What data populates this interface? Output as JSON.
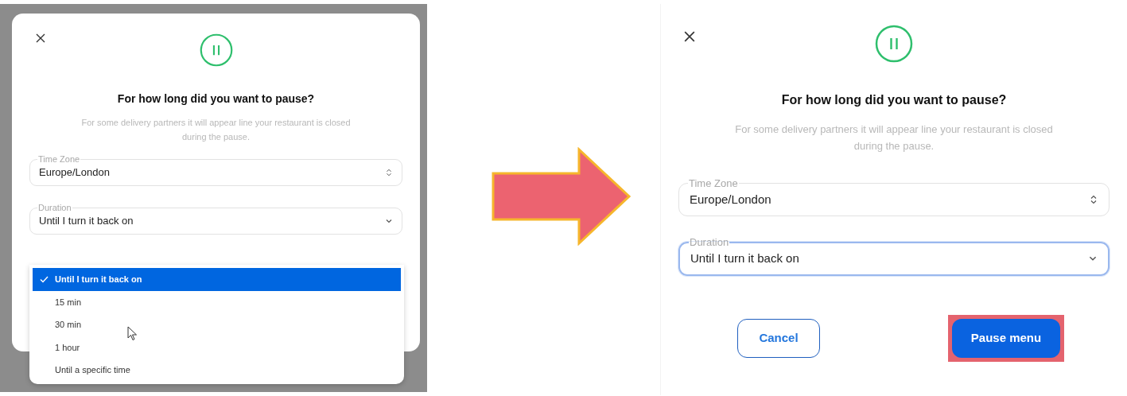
{
  "before": {
    "title": "For how long did you want to pause?",
    "description": "For some delivery partners it will appear line your restaurant is closed during the pause.",
    "fields": [
      {
        "kind": "stepper",
        "label": "Time Zone",
        "value": "Europe/London",
        "focused": false
      },
      {
        "kind": "dropdown",
        "label": "Duration",
        "value": "Until I turn it back on",
        "focused": false
      }
    ],
    "menu": {
      "options": [
        {
          "label": "Until I turn it back on",
          "selected": true
        },
        {
          "label": "15 min",
          "selected": false
        },
        {
          "label": "30 min",
          "selected": false
        },
        {
          "label": "1 hour",
          "selected": false
        },
        {
          "label": "Until a specific time",
          "selected": false
        }
      ]
    }
  },
  "after": {
    "title": "For how long did you want to pause?",
    "description": "For some delivery partners it will appear line your restaurant is closed during the pause.",
    "fields": [
      {
        "kind": "stepper",
        "label": "Time Zone",
        "value": "Europe/London",
        "focused": false
      },
      {
        "kind": "dropdown",
        "label": "Duration",
        "value": "Until I turn it back on",
        "focused": true
      }
    ],
    "buttons": [
      {
        "kind": "secondary",
        "label": "Cancel",
        "highlighted": false
      },
      {
        "kind": "primary",
        "label": "Pause menu",
        "highlighted": true
      }
    ]
  }
}
